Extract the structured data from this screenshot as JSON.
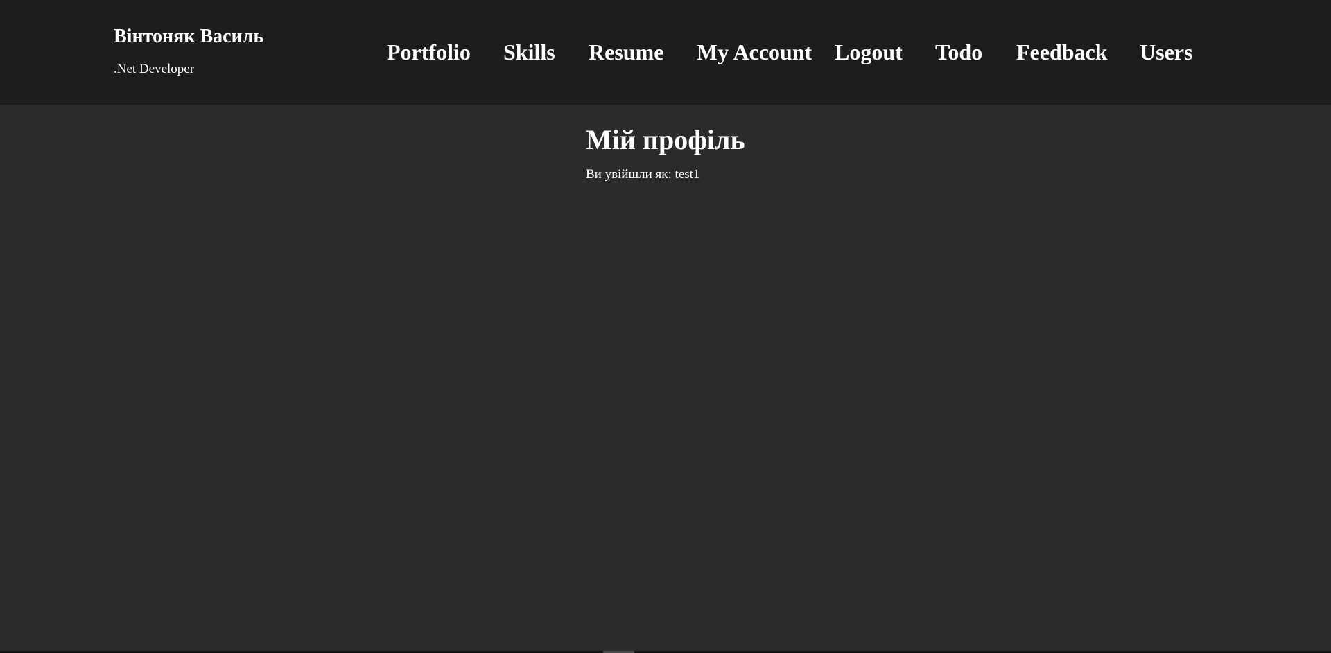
{
  "header": {
    "brand_name": "Вінтоняк Василь",
    "brand_role": ".Net Developer"
  },
  "nav": {
    "items": [
      {
        "label": "Portfolio"
      },
      {
        "label": "Skills"
      },
      {
        "label": "Resume"
      },
      {
        "label": "My Account"
      },
      {
        "label": "Logout"
      },
      {
        "label": "Todo"
      },
      {
        "label": "Feedback"
      },
      {
        "label": "Users"
      }
    ]
  },
  "main": {
    "title": "Мій профіль",
    "login_info": "Ви увійшли як: test1"
  },
  "colors": {
    "header_bg": "#1c1d1f",
    "page_bg": "#2b2b2b",
    "text": "#ffffff"
  }
}
